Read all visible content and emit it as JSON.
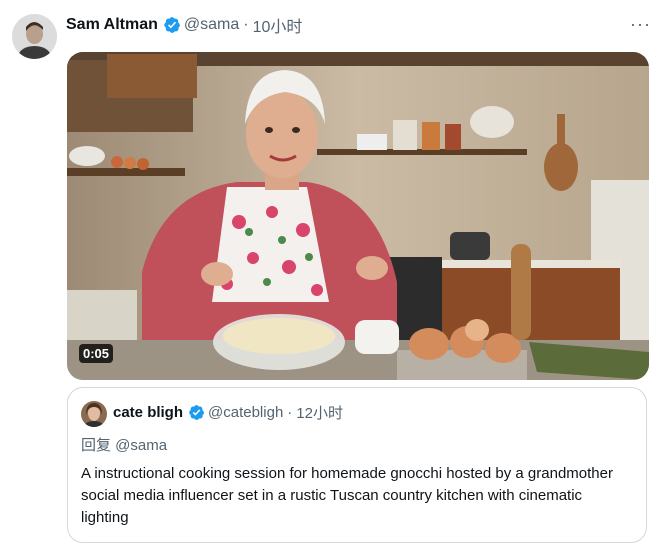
{
  "tweet": {
    "author_name": "Sam Altman",
    "handle": "@sama",
    "separator": "·",
    "time": "10小时",
    "more_label": "···",
    "video_duration": "0:05"
  },
  "quote": {
    "author_name": "cate bligh",
    "handle": "@catebligh",
    "separator": "·",
    "time": "12小时",
    "reply_to": "回复 @sama",
    "text": "A instructional cooking session for homemade gnocchi hosted by a grandmother social media influencer set in a rustic Tuscan country kitchen with cinematic lighting"
  },
  "icons": {
    "verified": "verified-badge-icon",
    "more": "more-options-icon"
  },
  "colors": {
    "verified_blue": "#1d9bf0",
    "secondary_text": "#536471",
    "border": "#cfd9de"
  }
}
